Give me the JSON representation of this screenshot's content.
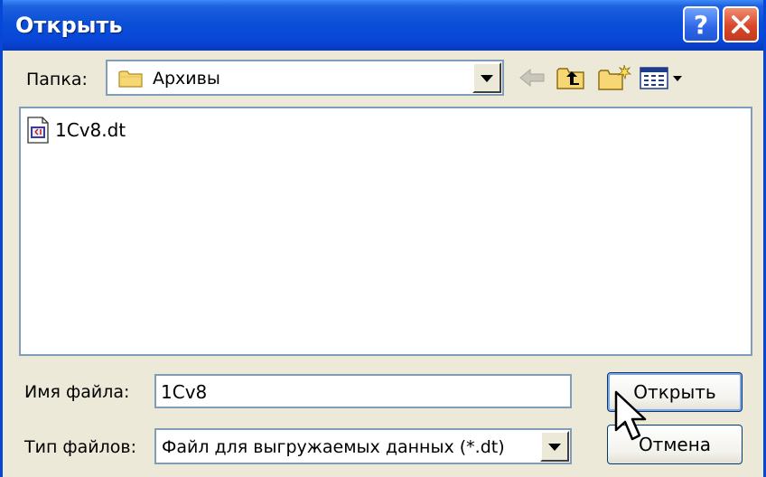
{
  "window": {
    "title": "Открыть"
  },
  "folder": {
    "label": "Папка:",
    "current": "Архивы"
  },
  "toolbar": {
    "back_icon": "back-arrow-icon",
    "up_icon": "folder-up-icon",
    "new_folder_icon": "new-folder-icon",
    "view_menu_icon": "view-menu-icon"
  },
  "files": [
    {
      "name": "1Cv8.dt",
      "icon": "dt-file-icon"
    }
  ],
  "filename": {
    "label": "Имя файла:",
    "value": "1Cv8"
  },
  "filetype": {
    "label": "Тип файлов:",
    "value": "Файл для выгружаемых данных (*.dt)"
  },
  "buttons": {
    "open": "Открыть",
    "cancel": "Отмена"
  },
  "colors": {
    "titlebar": "#0846D8",
    "dialog_bg": "#ECE9D8",
    "field_border": "#7F9DB9"
  }
}
